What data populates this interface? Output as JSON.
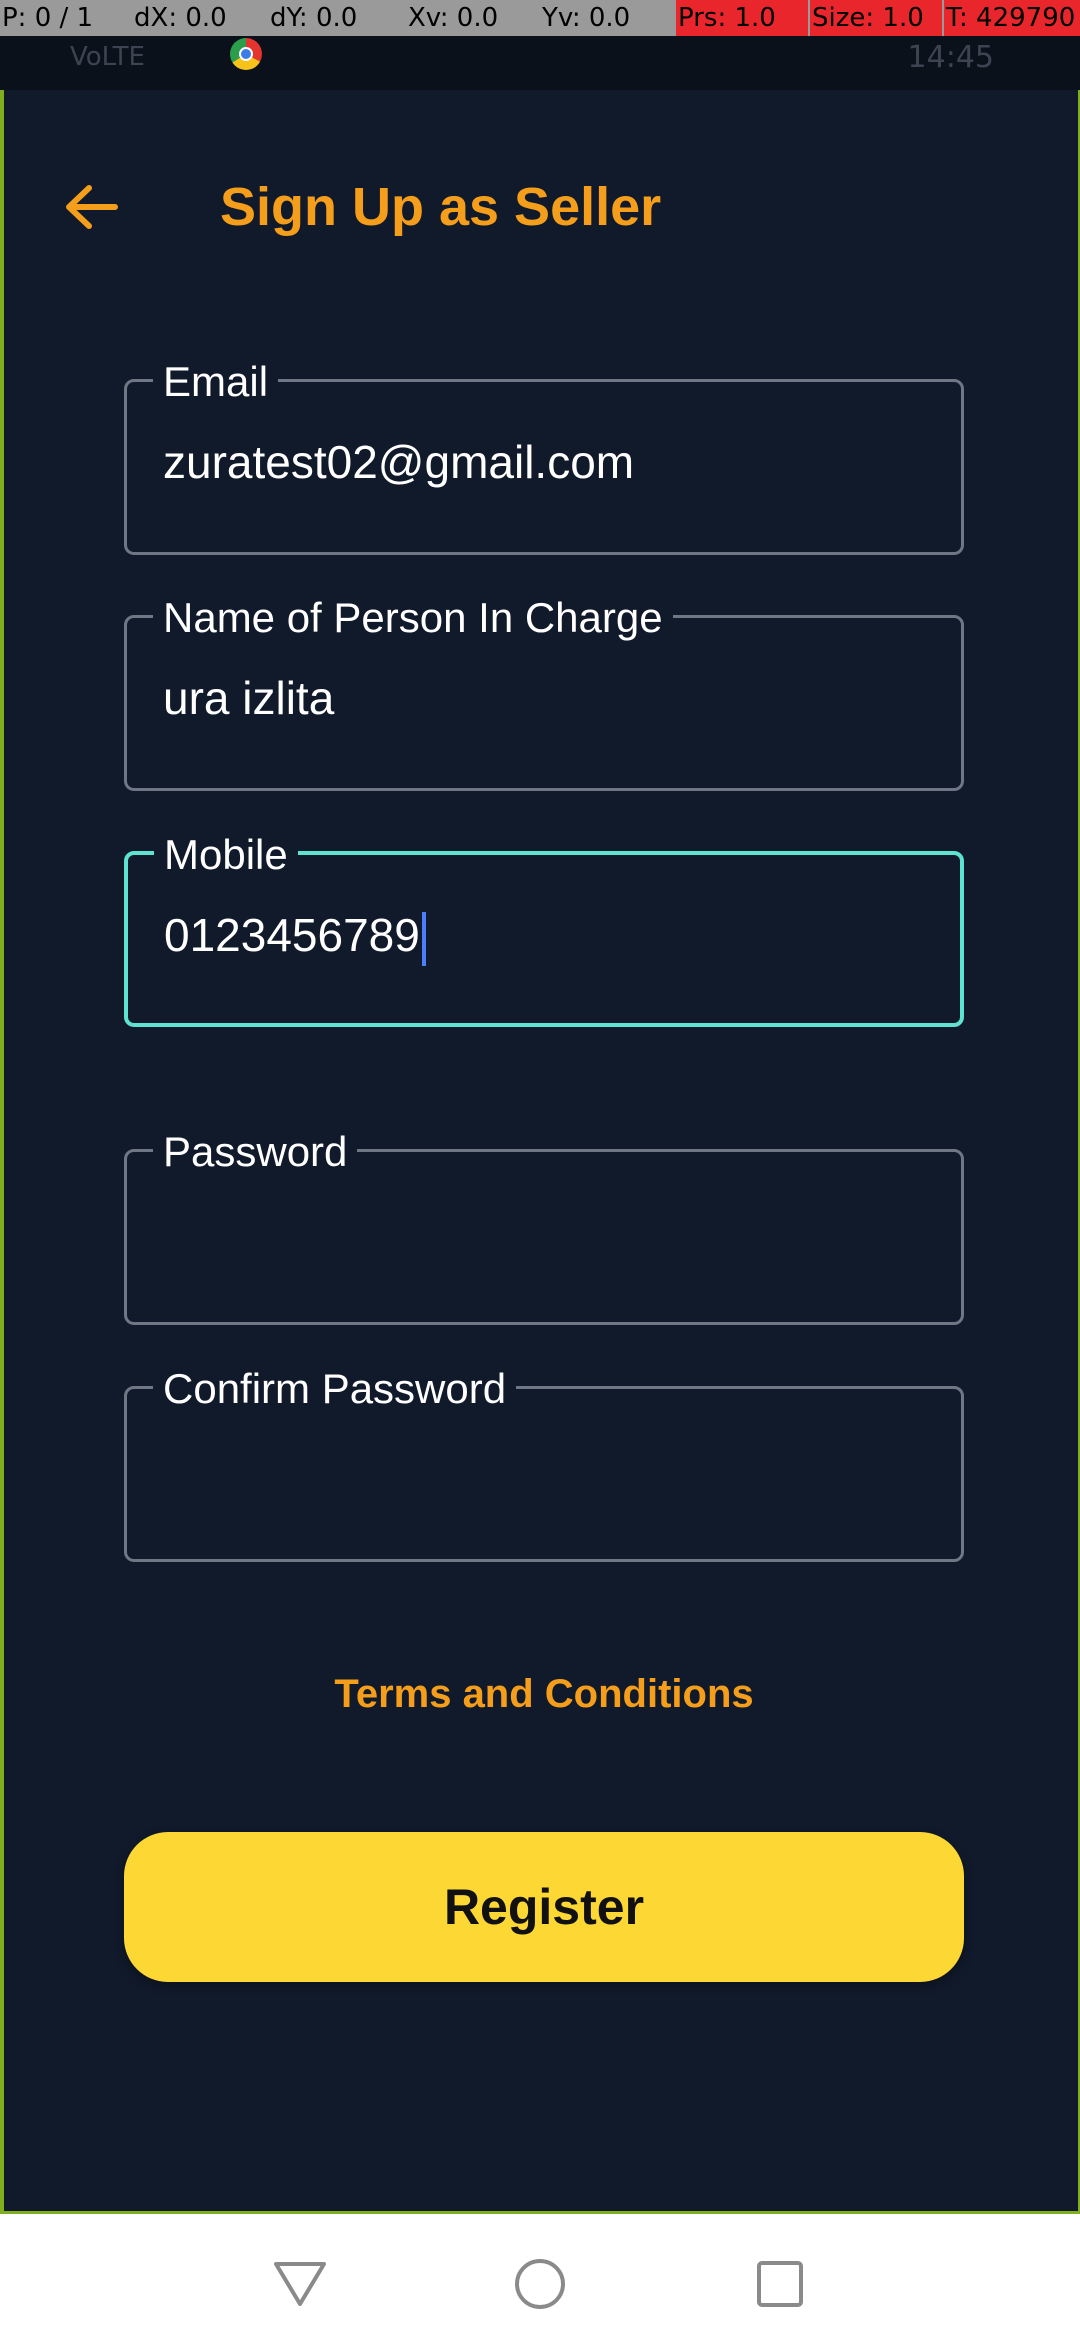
{
  "debug_overlay": {
    "pointer": "P: 0 / 1",
    "dx": "dX: 0.0",
    "dy": "dY: 0.0",
    "xv": "Xv: 0.0",
    "yv": "Yv: 0.0",
    "prs": "Prs: 1.0",
    "size": "Size: 1.0",
    "t": "T: 429790"
  },
  "status_bar": {
    "left_icons": "VoLTE",
    "time": "14:45"
  },
  "header": {
    "back_icon": "arrow-left-icon",
    "title": "Sign Up as Seller"
  },
  "form": {
    "email": {
      "label": "Email",
      "value": "zuratest02@gmail.com"
    },
    "person_in_charge": {
      "label": "Name of Person In Charge",
      "value": "ura izlita"
    },
    "mobile": {
      "label": "Mobile",
      "value": "0123456789"
    },
    "password": {
      "label": "Password",
      "value": ""
    },
    "confirm_password": {
      "label": "Confirm Password",
      "value": ""
    }
  },
  "terms_link": "Terms and Conditions",
  "register_button": "Register",
  "nav_bar": {
    "back": "triangle-back-icon",
    "home": "circle-home-icon",
    "recents": "square-recents-icon"
  },
  "colors": {
    "background": "#111a2b",
    "accent_orange": "#f59e1b",
    "button_yellow": "#fdd835",
    "focus_teal": "#5de3d0"
  }
}
